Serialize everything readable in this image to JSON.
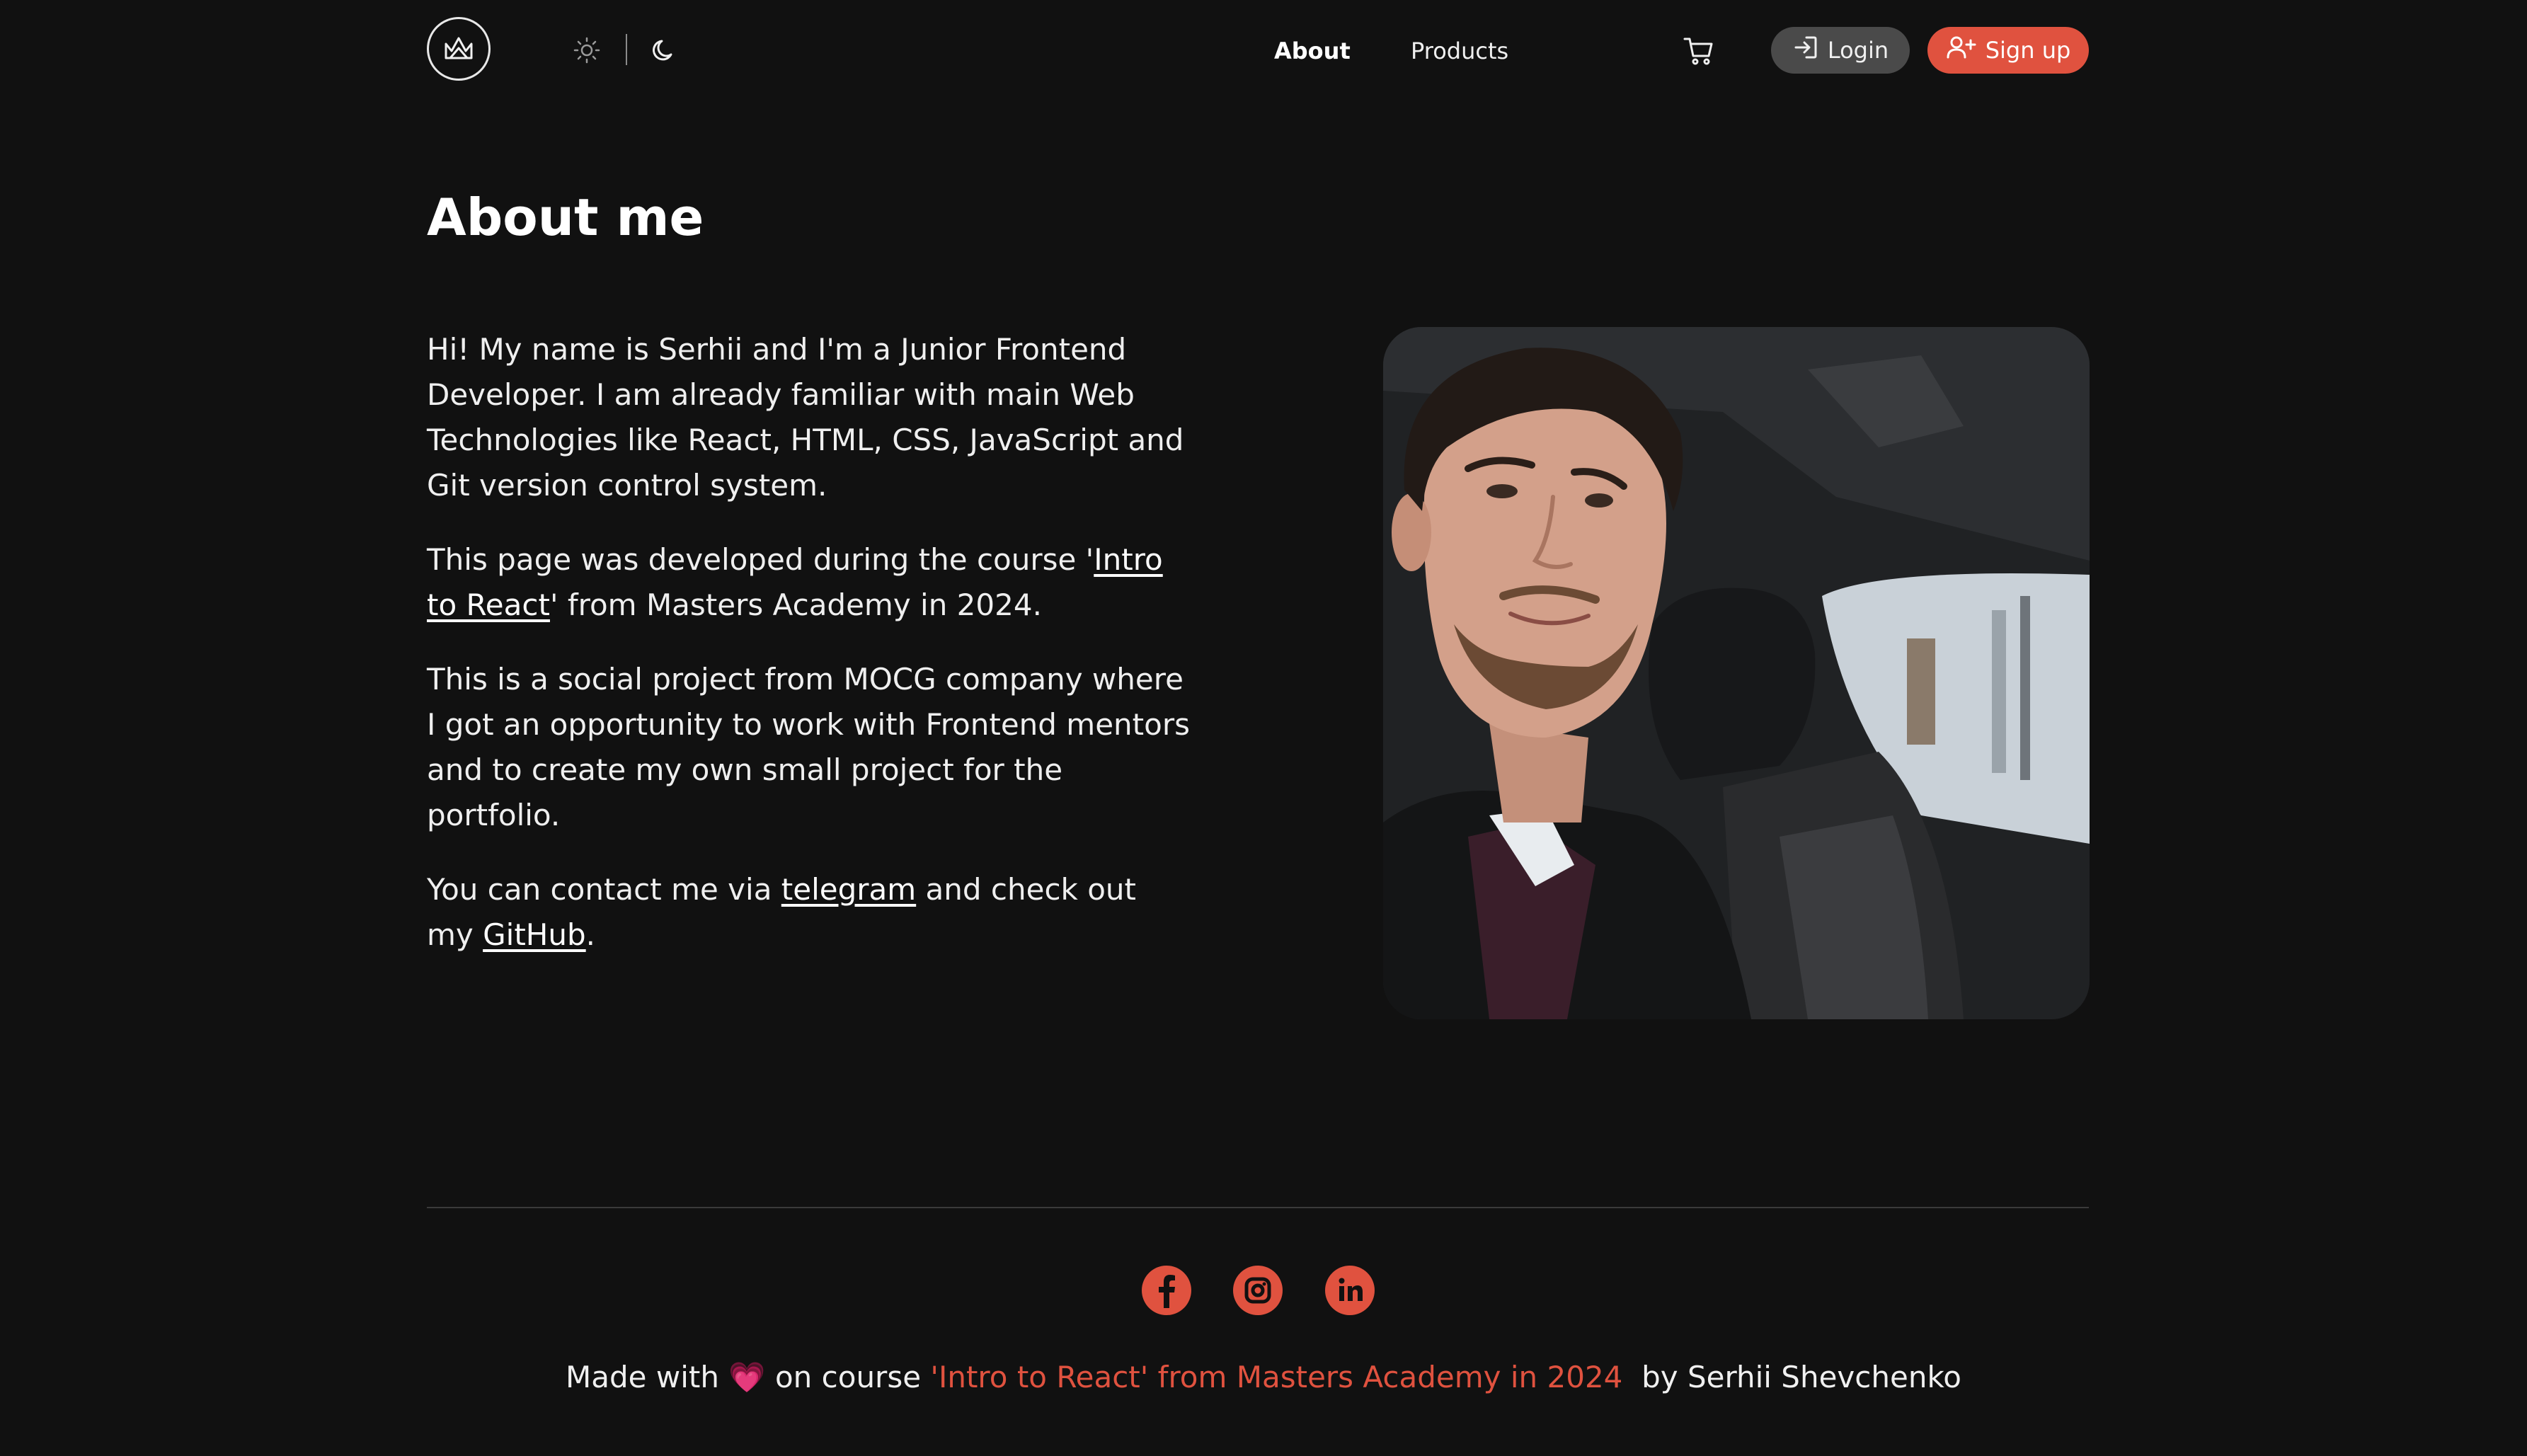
{
  "header": {
    "logo": "crown-icon",
    "theme_light_icon": "sun-icon",
    "theme_dark_icon": "moon-icon",
    "nav": {
      "about": "About",
      "products": "Products"
    },
    "cart_icon": "cart-icon",
    "login": {
      "label": "Login",
      "icon": "login-icon"
    },
    "signup": {
      "label": "Sign up",
      "icon": "user-plus-icon"
    }
  },
  "main": {
    "title": "About me",
    "p1": "Hi! My name is Serhii and I'm a Junior Frontend Developer. I am already familiar with main Web Technologies like React, HTML, CSS, JavaScript and Git version control system.",
    "p2": {
      "before": "This page was developed during the course '",
      "link": "Intro to React",
      "after": "' from Masters Academy in 2024."
    },
    "p3": "This is a social project from MOCG company where I got an opportunity to work with Frontend mentors and to create my own small project for the portfolio.",
    "p4": {
      "before": "You can contact me via ",
      "telegram": "telegram",
      "middle": " and check out my ",
      "github": "GitHub",
      "after": "."
    },
    "photo": "profile-photo"
  },
  "footer": {
    "socials": [
      "facebook-icon",
      "instagram-icon",
      "linkedin-icon"
    ],
    "made_with": "Made with",
    "heart": "💗",
    "on_course": "on course",
    "course": "'Intro to React' from Masters Academy in 2024",
    "by": "by Serhii Shevchenko"
  },
  "colors": {
    "background": "#111111",
    "accent": "#e0523f",
    "login_bg": "#4a4a4a",
    "text": "#f2f2f2"
  }
}
